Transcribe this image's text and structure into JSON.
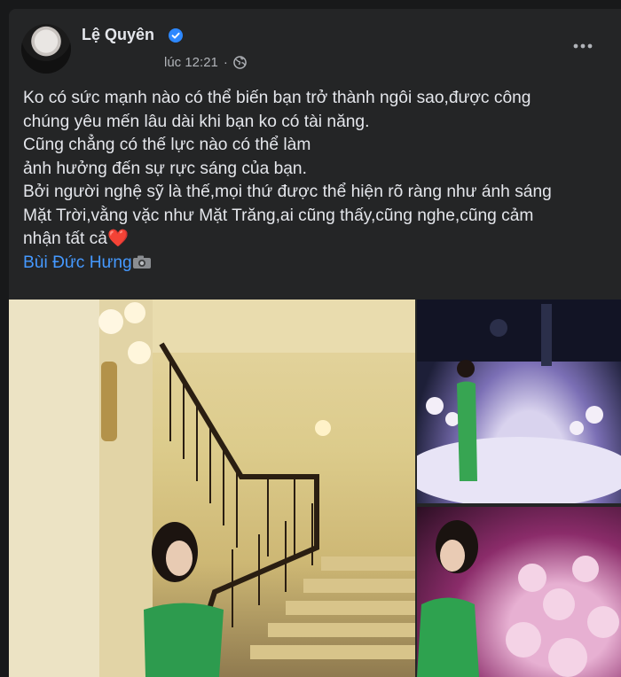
{
  "post": {
    "author": "Lệ Quyên",
    "time": "lúc 12:21",
    "separator": "·",
    "lines": [
      "Ko có sức mạnh nào có thể biến bạn trở thành ngôi sao,được công",
      "chúng yêu mến lâu dài khi bạn ko có tài năng.",
      "Cũng chẳng có thế lực nào có thể làm",
      "ảnh hưởng đến sự rực sáng của bạn.",
      "Bởi người nghệ sỹ là thế,mọi thứ được thể hiện rõ ràng như ánh sáng",
      "Mặt Trời,vằng vặc như Mặt Trăng,ai cũng thấy,cũng nghe,cũng cảm",
      "nhận tất cả"
    ],
    "heart": "❤️",
    "credit": "Bùi Đức Hưng",
    "icons": {
      "verified": "verified-badge-icon",
      "privacy": "globe-icon",
      "more": "more-options-icon",
      "camera": "camera-icon"
    },
    "colors": {
      "verified": "#2d88ff",
      "link": "#4599ff"
    }
  }
}
